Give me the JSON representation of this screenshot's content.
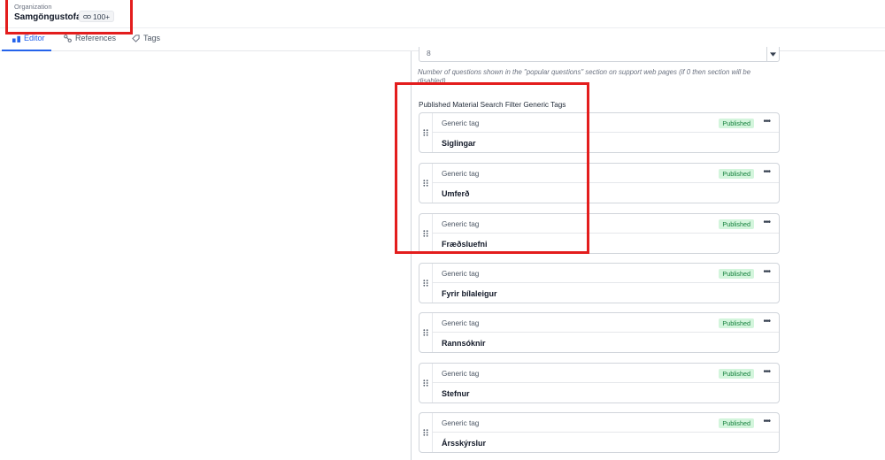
{
  "header": {
    "org_label": "Organization",
    "org_name": "Samgöngustofa",
    "references_badge": "100+",
    "references_icon": "link-icon"
  },
  "tabs": [
    {
      "label": "Editor",
      "icon": "editor-icon",
      "active": true
    },
    {
      "label": "References",
      "icon": "references-icon",
      "active": false
    },
    {
      "label": "Tags",
      "icon": "tag-icon",
      "active": false
    }
  ],
  "field": {
    "value": "8",
    "help": "Number of questions shown in the \"popular questions\" section on support web pages (if 0 then section will be disabled)"
  },
  "section": {
    "title": "Published Material Search Filter Generic Tags"
  },
  "tags": [
    {
      "type": "Generic tag",
      "name": "Siglingar",
      "status": "Published"
    },
    {
      "type": "Generic tag",
      "name": "Umferð",
      "status": "Published"
    },
    {
      "type": "Generic tag",
      "name": "Fræðsluefni",
      "status": "Published"
    },
    {
      "type": "Generic tag",
      "name": "Fyrir bílaleigur",
      "status": "Published"
    },
    {
      "type": "Generic tag",
      "name": "Rannsóknir",
      "status": "Published"
    },
    {
      "type": "Generic tag",
      "name": "Stefnur",
      "status": "Published"
    },
    {
      "type": "Generic tag",
      "name": "Ársskýrslur",
      "status": "Published"
    }
  ],
  "colors": {
    "accent": "#2563eb",
    "highlight": "#e31d1d",
    "published_bg": "#d3f5dc",
    "published_text": "#15803d"
  }
}
